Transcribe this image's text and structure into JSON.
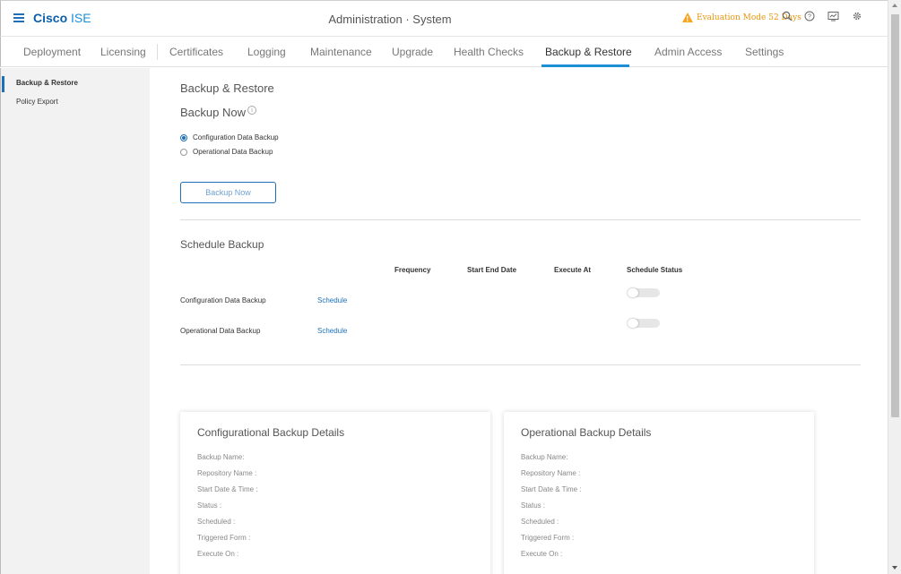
{
  "header": {
    "brand_cisco": "Cisco",
    "brand_ise": "ISE",
    "title": "Administration · System",
    "evaluation": "Evaluation Mode 52 Days",
    "icons": [
      "search-icon",
      "help-icon",
      "notifications-icon",
      "gear-icon"
    ]
  },
  "tabs": [
    {
      "label": "Deployment"
    },
    {
      "label": "Licensing"
    },
    {
      "label": "Certificates"
    },
    {
      "label": "Logging"
    },
    {
      "label": "Maintenance"
    },
    {
      "label": "Upgrade"
    },
    {
      "label": "Health Checks"
    },
    {
      "label": "Backup & Restore",
      "active": true
    },
    {
      "label": "Admin Access"
    },
    {
      "label": "Settings"
    }
  ],
  "sidebar": {
    "items": [
      {
        "label": "Backup & Restore",
        "active": true
      },
      {
        "label": "Policy Export"
      }
    ]
  },
  "main": {
    "heading": "Backup & Restore",
    "backup_now_heading": "Backup Now",
    "radio_config": "Configuration Data Backup",
    "radio_operational": "Operational Data Backup",
    "backup_now_button": "Backup Now",
    "schedule_heading": "Schedule Backup",
    "columns": {
      "frequency": "Frequency",
      "start_end": "Start End Date",
      "execute_at": "Execute At",
      "status": "Schedule Status"
    },
    "rows": [
      {
        "label": "Configuration Data Backup",
        "link": "Schedule"
      },
      {
        "label": "Operational Data Backup",
        "link": "Schedule"
      }
    ]
  },
  "cards": {
    "config": {
      "title": "Configurational Backup Details",
      "fields": [
        "Backup Name:",
        "Repository Name :",
        "Start Date & Time :",
        "Status :",
        "Scheduled :",
        "Triggered Form :",
        "Execute On :"
      ]
    },
    "operational": {
      "title": "Operational Backup Details",
      "fields": [
        "Backup Name:",
        "Repository Name :",
        "Start Date & Time :",
        "Status :",
        "Scheduled :",
        "Triggered Form :",
        "Execute On :"
      ]
    }
  },
  "colors": {
    "accent": "#1d6fb8",
    "tab_underline": "#1d8fd6",
    "warning": "#f5a623"
  }
}
